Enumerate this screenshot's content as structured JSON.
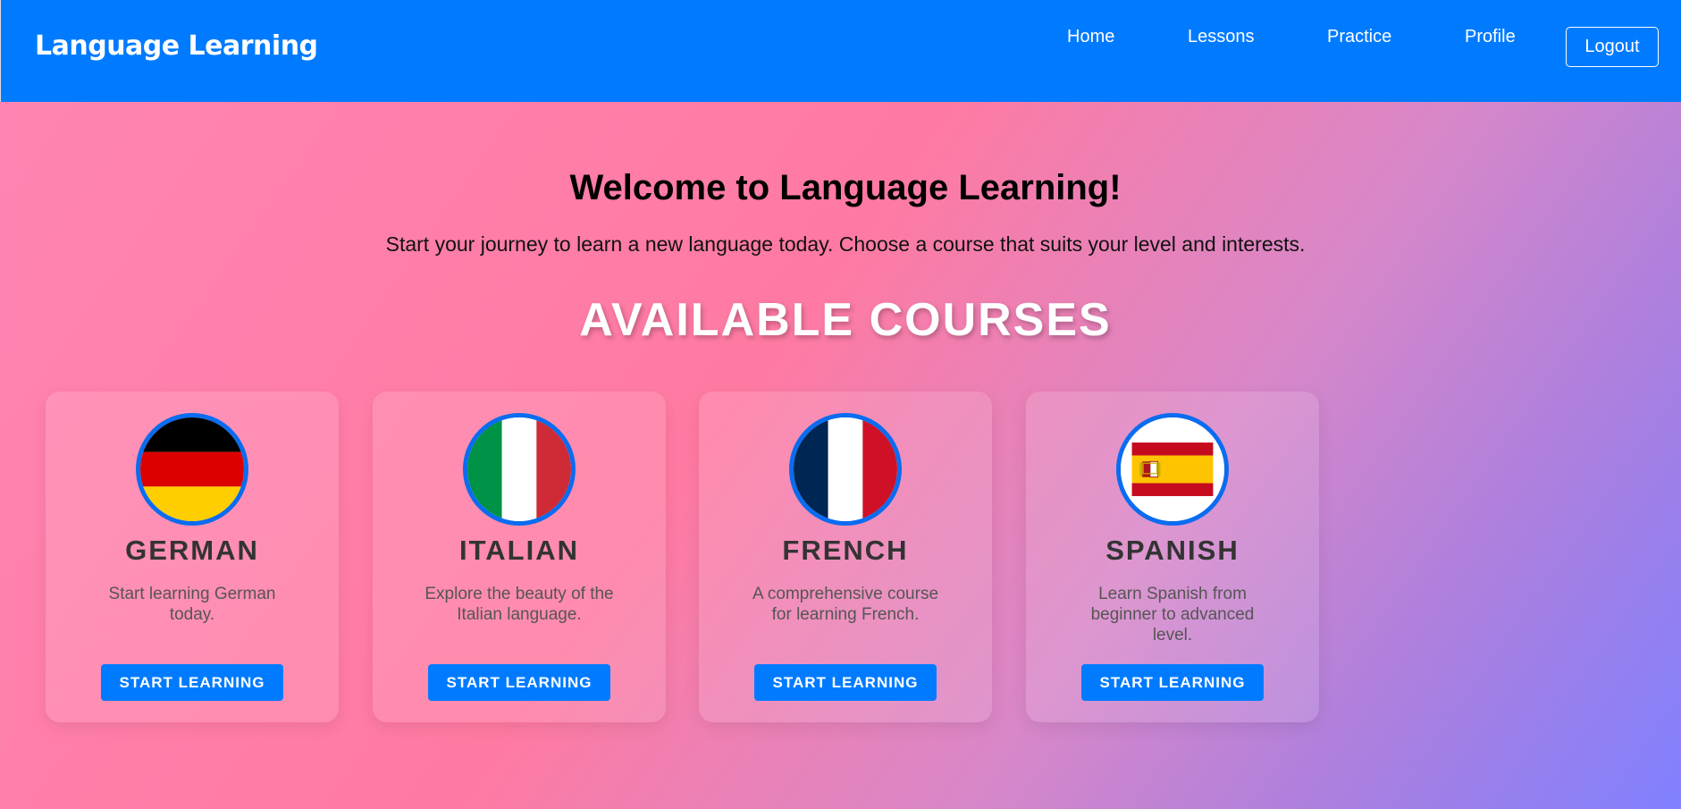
{
  "header": {
    "brand": "Language Learning",
    "nav": [
      {
        "label": "Home"
      },
      {
        "label": "Lessons"
      },
      {
        "label": "Practice"
      },
      {
        "label": "Profile"
      }
    ],
    "logout_label": "Logout"
  },
  "hero": {
    "title": "Welcome to Language Learning!",
    "subtitle": "Start your journey to learn a new language today. Choose a course that suits your level and interests."
  },
  "courses_section": {
    "title": "AVAILABLE COURSES",
    "courses": [
      {
        "name": "GERMAN",
        "description": "Start learning German today.",
        "button": "START LEARNING",
        "flag_icon": "germany-flag-icon"
      },
      {
        "name": "ITALIAN",
        "description": "Explore the beauty of the Italian language.",
        "button": "START LEARNING",
        "flag_icon": "italy-flag-icon"
      },
      {
        "name": "FRENCH",
        "description": "A comprehensive course for learning French.",
        "button": "START LEARNING",
        "flag_icon": "france-flag-icon"
      },
      {
        "name": "SPANISH",
        "description": "Learn Spanish from beginner to advanced level.",
        "button": "START LEARNING",
        "flag_icon": "spain-flag-icon"
      }
    ]
  },
  "colors": {
    "primary": "#007bff",
    "flag_border": "#0a6cf0"
  }
}
